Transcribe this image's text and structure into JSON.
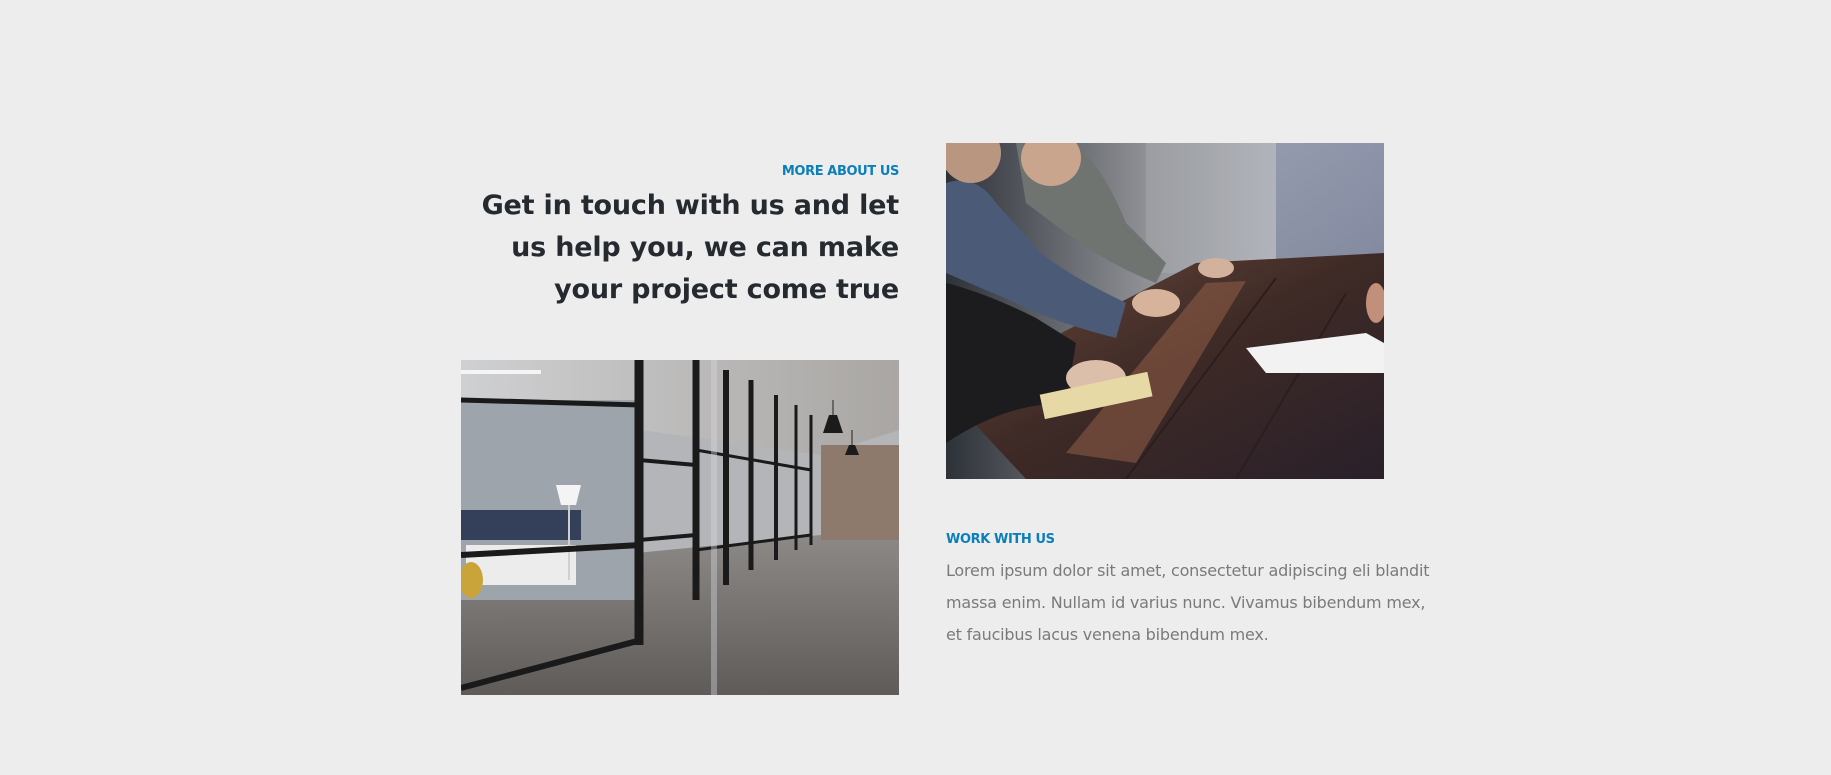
{
  "about": {
    "eyebrow": "MORE ABOUT US",
    "headline": "Get in touch with us and let us help you, we can make your project come true"
  },
  "work": {
    "eyebrow": "WORK WITH US",
    "body": "Lorem ipsum dolor sit amet, consectetur adipiscing eli blandit massa enim. Nullam id varius nunc. Vivamus bibendum mex, et faucibus lacus venena bibendum mex."
  },
  "images": {
    "meeting": "meeting-photo",
    "office": "office-corridor-photo"
  },
  "colors": {
    "background": "#ededed",
    "accent": "#0b7fb8",
    "heading": "#252a30",
    "body": "#7a7a7a"
  }
}
